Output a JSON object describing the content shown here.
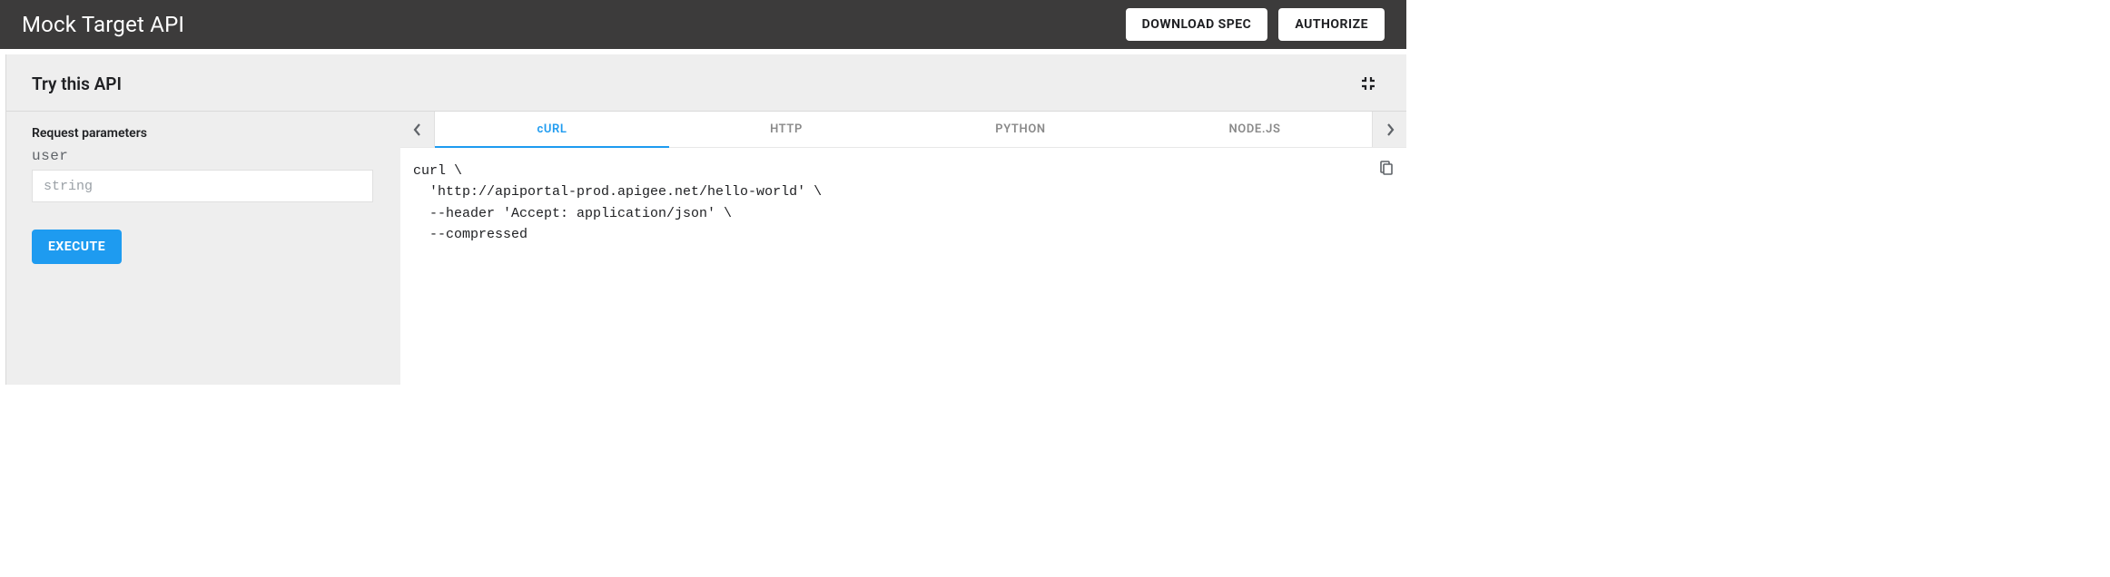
{
  "header": {
    "title": "Mock Target API",
    "download_label": "DOWNLOAD SPEC",
    "authorize_label": "AUTHORIZE"
  },
  "panel": {
    "title": "Try this API"
  },
  "request": {
    "section_label": "Request parameters",
    "params": [
      {
        "name": "user",
        "placeholder": "string",
        "value": ""
      }
    ],
    "execute_label": "EXECUTE"
  },
  "code": {
    "tabs": [
      "cURL",
      "HTTP",
      "PYTHON",
      "NODE.JS"
    ],
    "active_tab_index": 0,
    "snippet": "curl \\\n  'http://apiportal-prod.apigee.net/hello-world' \\\n  --header 'Accept: application/json' \\\n  --compressed"
  }
}
